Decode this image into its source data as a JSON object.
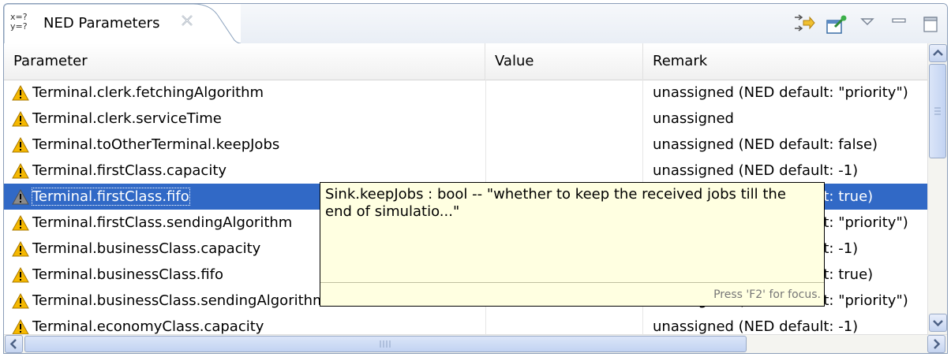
{
  "view": {
    "tab_icon_line1": "x=?",
    "tab_icon_line2": "y=?",
    "title": "NED Parameters"
  },
  "icons": {
    "tab": "parameter-view-icon",
    "close": "close-icon",
    "toolbar": [
      "link-with-editor-icon",
      "pin-icon",
      "view-menu-icon",
      "minimize-icon",
      "maximize-icon"
    ],
    "row": "warning-icon"
  },
  "table": {
    "columns": [
      "Parameter",
      "Value",
      "Remark"
    ],
    "rows": [
      {
        "parameter": "Terminal.clerk.fetchingAlgorithm",
        "value": "",
        "remark": "unassigned (NED default: \"priority\")"
      },
      {
        "parameter": "Terminal.clerk.serviceTime",
        "value": "",
        "remark": "unassigned"
      },
      {
        "parameter": "Terminal.toOtherTerminal.keepJobs",
        "value": "",
        "remark": "unassigned (NED default: false)"
      },
      {
        "parameter": "Terminal.firstClass.capacity",
        "value": "",
        "remark": "unassigned (NED default: -1)"
      },
      {
        "parameter": "Terminal.firstClass.fifo",
        "value": "",
        "remark": "unassigned (NED default: true)"
      },
      {
        "parameter": "Terminal.firstClass.sendingAlgorithm",
        "value": "",
        "remark": "unassigned (NED default: \"priority\")"
      },
      {
        "parameter": "Terminal.businessClass.capacity",
        "value": "",
        "remark": "unassigned (NED default: -1)"
      },
      {
        "parameter": "Terminal.businessClass.fifo",
        "value": "",
        "remark": "unassigned (NED default: true)"
      },
      {
        "parameter": "Terminal.businessClass.sendingAlgorithm",
        "value": "",
        "remark": "unassigned (NED default: \"priority\")"
      },
      {
        "parameter": "Terminal.economyClass.capacity",
        "value": "",
        "remark": "unassigned (NED default: -1)"
      }
    ],
    "selected_index": 4
  },
  "tooltip": {
    "text": "Sink.keepJobs : bool -- \"whether to keep the received jobs till the end of simulatio...\"",
    "footer": "Press 'F2' for focus."
  },
  "colors": {
    "selection": "#3169c6",
    "tooltip_bg": "#ffffe1",
    "warning": "#f5b800"
  }
}
